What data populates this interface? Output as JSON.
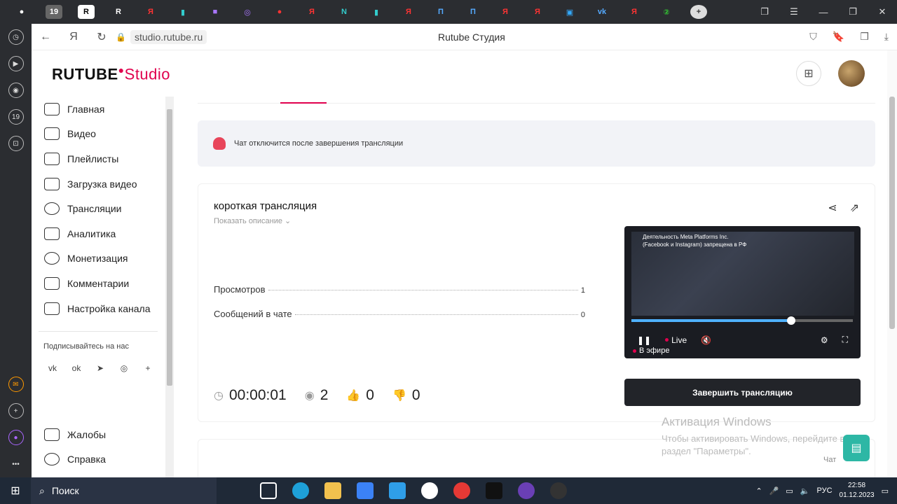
{
  "browser": {
    "url": "studio.rutube.ru",
    "page_title": "Rutube Студия",
    "tab_count_badge": "19"
  },
  "header": {
    "logo_main": "RUTUBE",
    "logo_studio": "Studio"
  },
  "sidebar": {
    "items": [
      {
        "label": "Главная"
      },
      {
        "label": "Видео"
      },
      {
        "label": "Плейлисты"
      },
      {
        "label": "Загрузка видео"
      },
      {
        "label": "Трансляции"
      },
      {
        "label": "Аналитика"
      },
      {
        "label": "Монетизация"
      },
      {
        "label": "Комментарии"
      },
      {
        "label": "Настройка канала"
      }
    ],
    "subscribe_label": "Подписывайтесь на нас",
    "bottom_items": [
      {
        "label": "Жалобы"
      },
      {
        "label": "Справка"
      }
    ]
  },
  "notice": {
    "text": "Чат отключится после завершения трансляции"
  },
  "stream": {
    "title": "короткая трансляция",
    "show_description": "Показать описание",
    "views_label": "Просмотров",
    "views_value": "1",
    "messages_label": "Сообщений в чате",
    "messages_value": "0",
    "duration": "00:00:01",
    "viewers": "2",
    "likes": "0",
    "dislikes": "0",
    "end_button": "Завершить трансляцию"
  },
  "player": {
    "live_label": "Live",
    "on_air_label": "В эфире",
    "banner_line1": "Деятельность Meta Platforms Inc.",
    "banner_line2": "(Facebook и Instagram) запрещена в РФ",
    "progress": 0.72
  },
  "watermark": {
    "title": "Активация Windows",
    "line1": "Чтобы активировать Windows, перейдите в",
    "line2": "раздел \"Параметры\"."
  },
  "chat_label": "Чат",
  "taskbar": {
    "search_label": "Поиск",
    "lang": "РУС",
    "time": "22:58",
    "date": "01.12.2023"
  }
}
